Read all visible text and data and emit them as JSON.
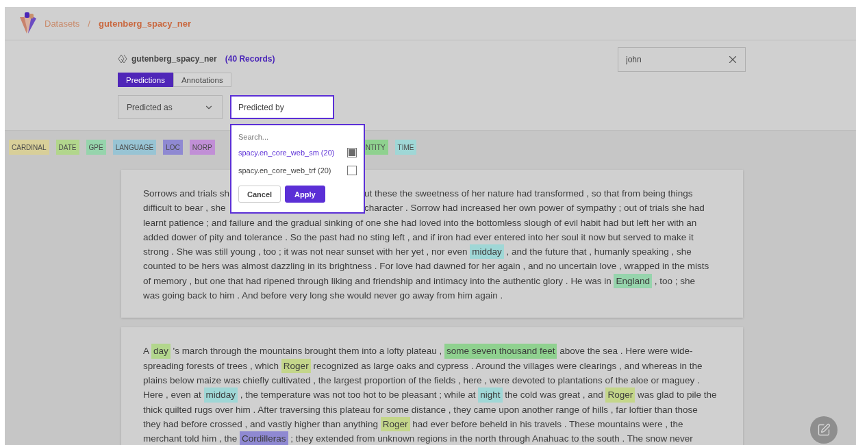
{
  "breadcrumbs": [
    {
      "label": "Datasets",
      "current": false
    },
    {
      "label": "gutenberg_spacy_ner",
      "current": true
    }
  ],
  "breadcrumb_separator": "/",
  "dataset": {
    "name": "gutenberg_spacy_ner",
    "count": "(40 Records)"
  },
  "tabs": [
    {
      "label": "Predictions",
      "selected": true
    },
    {
      "label": "Annotations",
      "selected": false
    }
  ],
  "predicted_as": {
    "placeholder": "Predicted as"
  },
  "predicted_by": {
    "placeholder": "Predicted by",
    "search_placeholder": "Search...",
    "options": [
      {
        "label": "spacy.en_core_web_sm (20)",
        "checked": true
      },
      {
        "label": "spacy.en_core_web_trf (20)",
        "checked": false
      }
    ],
    "buttons": [
      "Cancel",
      "Apply"
    ]
  },
  "search": {
    "value": "john"
  },
  "tags": [
    {
      "label": "CARDINAL",
      "color": "#d8cf99"
    },
    {
      "label": "DATE",
      "color": "#b2d68c"
    },
    {
      "label": "GPE",
      "color": "#96d4ac"
    },
    {
      "label": "LANGUAGE",
      "color": "#98c4d4"
    },
    {
      "label": "LOC",
      "color": "#8f89d2"
    },
    {
      "label": "NORP",
      "color": "#c18fd6"
    }
  ],
  "tags_after_menu": [
    {
      "label": "NTITY",
      "color": "#8fd18f"
    },
    {
      "label": "TIME",
      "color": "#9fd7d6"
    }
  ],
  "records": [
    {
      "lines": [
        {
          "before": [
            {
              "text": "Sorrows and trials sh"
            }
          ],
          "after": [
            {
              "text": "ut these the sweetness of her nature had transformed , so that from being things"
            }
          ]
        },
        {
          "before": [
            {
              "text": "difficult to bear , she"
            }
          ],
          "after": [
            {
              "text": "character . Sorrow had increased her own power of sympathy ; out of trials she had"
            }
          ]
        },
        {
          "segments": [
            {
              "text": "learnt patience ; and failure and the gradual sinking of one she had loved into the bottomless slough of evil habit had but left her with an"
            }
          ]
        },
        {
          "segments": [
            {
              "text": "added dower of pity and tolerance . So the past had no sting left , and if iron had ever entered into her soul it now but served to make it"
            }
          ]
        },
        {
          "segments": [
            {
              "text": "strong . She was still young , too ; it was not near sunset with her yet , nor even "
            },
            {
              "text": "midday",
              "color": "#9fd7d6"
            },
            {
              "text": " , and the future that , humanly speaking , she"
            }
          ]
        },
        {
          "segments": [
            {
              "text": "counted to be hers was almost dazzling in its brightness . For love had dawned for her again , and no uncertain love , wrapped in the mists"
            }
          ]
        },
        {
          "segments": [
            {
              "text": "of memory , but one that had ripened through liking and friendship and intimacy into the authentic glory . He was in "
            },
            {
              "text": "England",
              "color": "#96d4ac"
            },
            {
              "text": " , too ; she"
            }
          ]
        },
        {
          "segments": [
            {
              "text": "was going back to him . And before very long she would never go away from him again ."
            }
          ]
        }
      ]
    },
    {
      "lines": [
        {
          "segments": [
            {
              "text": "A "
            },
            {
              "text": "day",
              "color": "#b2d68c"
            },
            {
              "text": " 's march through the mountains brought them into a lofty plateau , "
            },
            {
              "text": "some seven thousand feet",
              "color": "#8fd18f"
            },
            {
              "text": " above the sea . Here were wide-"
            }
          ]
        },
        {
          "segments": [
            {
              "text": "spreading forests of trees , which "
            },
            {
              "text": "Roger",
              "color": "#c4d68a"
            },
            {
              "text": " recognized as large oaks and cypress . Around the villages were clearings , and whereas in the"
            }
          ]
        },
        {
          "segments": [
            {
              "text": "plains below maize was chiefly cultivated , the largest proportion of the fields , here , were devoted to plantations of the aloe or maguey ."
            }
          ]
        },
        {
          "segments": [
            {
              "text": "Here , even at "
            },
            {
              "text": "midday",
              "color": "#9fd7d6"
            },
            {
              "text": " , the temperature was not too hot to be pleasant ; while at "
            },
            {
              "text": "night",
              "color": "#9fd7d6"
            },
            {
              "text": " the cold was great , and "
            },
            {
              "text": "Roger",
              "color": "#c4d68a"
            },
            {
              "text": " was glad to pile the"
            }
          ]
        },
        {
          "segments": [
            {
              "text": "thick quilted rugs over him . After traversing this plateau for some distance , they came upon another range of hills , far loftier than those"
            }
          ]
        },
        {
          "segments": [
            {
              "text": "they had before crossed , and vastly higher than anything "
            },
            {
              "text": "Roger",
              "color": "#c4d68a"
            },
            {
              "text": " had ever before beheld in his travels . These mountains were , the"
            }
          ]
        },
        {
          "segments": [
            {
              "text": "merchant told him , the "
            },
            {
              "text": "Cordilleras",
              "color": "#8f89d2"
            },
            {
              "text": " ; they extended from unknown regions in the north through Anahuac to the south . The snow never"
            }
          ]
        }
      ]
    }
  ]
}
